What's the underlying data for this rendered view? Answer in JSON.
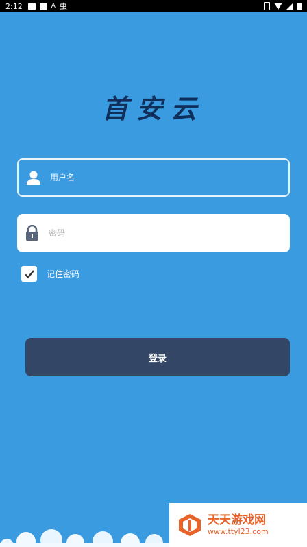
{
  "status_bar": {
    "time": "2:12",
    "icon_a": "A",
    "icon_bug": "虫"
  },
  "logo": {
    "text": "首安云"
  },
  "username": {
    "placeholder": "用户名",
    "icon": "user-icon"
  },
  "password": {
    "placeholder": "密码",
    "icon": "lock-icon"
  },
  "remember": {
    "label": "记住密码",
    "checked": true
  },
  "login_button": {
    "label": "登录"
  },
  "watermark": {
    "title": "天天游戏网",
    "url": "www.ttyl23.com"
  },
  "colors": {
    "background": "#3a9be0",
    "button": "#334665",
    "logo": "#0f2f5a",
    "watermark": "#e8622a"
  }
}
